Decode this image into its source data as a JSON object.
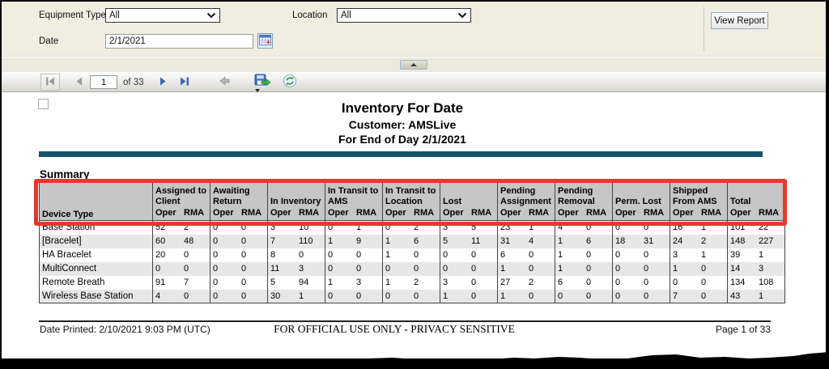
{
  "colors": {
    "highlight_red": "#e8362d",
    "divider_teal": "#17536d",
    "table_header_gray": "#c6c6c6",
    "panel_beige": "#f0eee1"
  },
  "icons": [
    "dropdown-chevron-icon",
    "calendar-icon",
    "first-page-icon",
    "prev-page-icon",
    "next-page-icon",
    "last-page-icon",
    "back-parent-icon",
    "save-export-icon",
    "export-caret-icon",
    "refresh-icon",
    "collapse-splitter-icon"
  ],
  "params": {
    "equipment_type_label": "Equipment Type",
    "equipment_type_value": "All",
    "location_label": "Location",
    "location_value": "All",
    "date_label": "Date",
    "date_value": "2/1/2021",
    "view_report_label": "View Report"
  },
  "pager": {
    "current_page": "1",
    "of_label": "of 33"
  },
  "report": {
    "title": "Inventory For Date",
    "customer": "Customer: AMSLive",
    "period": "For End of Day 2/1/2021",
    "section_title": "Summary"
  },
  "table": {
    "device_type_header": "Device Type",
    "sub_headers": [
      "Oper",
      "RMA"
    ],
    "groups": [
      "Assigned to\nClient",
      "Awaiting\nReturn",
      "In Inventory",
      "In Transit to\nAMS",
      "In Transit to\nLocation",
      "Lost",
      "Pending\nAssignment",
      "Pending\nRemoval",
      "Perm. Lost",
      "Shipped\nFrom AMS",
      "Total"
    ],
    "rows": [
      {
        "device": "Base Station",
        "values": [
          52,
          2,
          0,
          0,
          3,
          10,
          0,
          1,
          0,
          2,
          3,
          5,
          23,
          1,
          4,
          0,
          0,
          0,
          16,
          1,
          101,
          22
        ]
      },
      {
        "device": "[Bracelet]",
        "values": [
          60,
          48,
          0,
          0,
          7,
          110,
          1,
          9,
          1,
          6,
          5,
          11,
          31,
          4,
          1,
          6,
          18,
          31,
          24,
          2,
          148,
          227
        ]
      },
      {
        "device": "HA Bracelet",
        "values": [
          20,
          0,
          0,
          0,
          8,
          0,
          0,
          0,
          1,
          0,
          0,
          0,
          6,
          0,
          1,
          0,
          0,
          0,
          3,
          1,
          39,
          1
        ]
      },
      {
        "device": "MultiConnect",
        "values": [
          0,
          0,
          0,
          0,
          11,
          3,
          0,
          0,
          0,
          0,
          0,
          0,
          1,
          0,
          1,
          0,
          0,
          0,
          1,
          0,
          14,
          3
        ]
      },
      {
        "device": "Remote Breath",
        "values": [
          91,
          7,
          0,
          0,
          5,
          94,
          1,
          3,
          1,
          2,
          3,
          0,
          27,
          2,
          6,
          0,
          0,
          0,
          0,
          0,
          134,
          108
        ]
      },
      {
        "device": "Wireless Base Station",
        "values": [
          4,
          0,
          0,
          0,
          30,
          1,
          0,
          0,
          0,
          0,
          1,
          0,
          1,
          0,
          0,
          0,
          0,
          0,
          7,
          0,
          43,
          1
        ]
      }
    ]
  },
  "footer": {
    "date_printed": "Date Printed: 2/10/2021 9:03 PM (UTC)",
    "classification": "FOR OFFICIAL USE ONLY - PRIVACY SENSITIVE",
    "page_info": "Page 1 of 33"
  }
}
